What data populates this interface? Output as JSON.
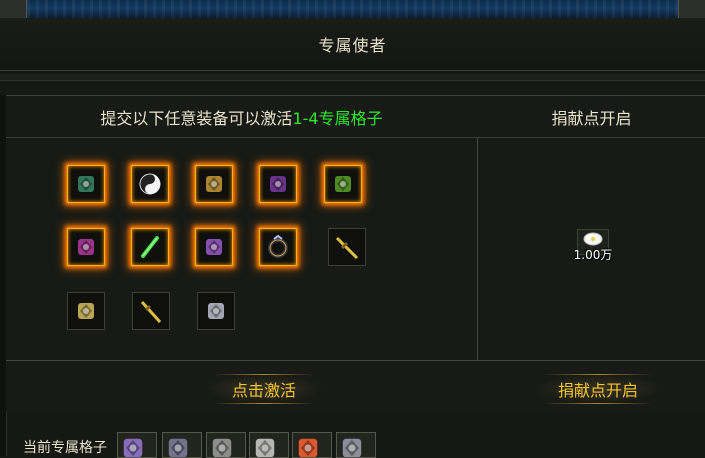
{
  "window": {
    "title": "专属使者"
  },
  "left_panel": {
    "header_prefix": "提交以下任意装备可以激活",
    "header_highlight": "1-4专属格子",
    "items": [
      {
        "icon": "green-helmet-icon",
        "glow": true,
        "color": "#3a8a6a"
      },
      {
        "icon": "yin-yang-icon",
        "glow": true,
        "color": "#ffffff"
      },
      {
        "icon": "gold-armor-icon",
        "glow": true,
        "color": "#c89a3a"
      },
      {
        "icon": "purple-armor-icon",
        "glow": true,
        "color": "#7a3aa0"
      },
      {
        "icon": "green-box-icon",
        "glow": true,
        "color": "#5aa02a"
      },
      {
        "icon": "purple-dragon-icon",
        "glow": true,
        "color": "#b03aa0"
      },
      {
        "icon": "green-wand-icon",
        "glow": true,
        "color": "#4ae04a"
      },
      {
        "icon": "purple-gauntlet-icon",
        "glow": true,
        "color": "#9a5ac8"
      },
      {
        "icon": "dark-ring-icon",
        "glow": true,
        "color": "#c8a060"
      },
      {
        "icon": "golden-sword-icon",
        "glow": false,
        "color": "#e0c040"
      },
      {
        "icon": "golden-crossbow-icon",
        "glow": false,
        "color": "#d8c060"
      },
      {
        "icon": "golden-blade-icon",
        "glow": false,
        "color": "#e0c040"
      },
      {
        "icon": "silver-armor-icon",
        "glow": false,
        "color": "#c0c0d0"
      }
    ],
    "activate_button": "点击激活"
  },
  "right_panel": {
    "header": "捐献点开启",
    "donate_item_icon": "silver-coin-icon",
    "donate_amount": "1.00万",
    "donate_button": "捐献点开启"
  },
  "bottom": {
    "label": "当前专属格子",
    "slots": [
      {
        "icon": "purple-orb-icon"
      },
      {
        "icon": "dark-dragon-icon"
      },
      {
        "icon": "spiked-weapon-icon"
      },
      {
        "icon": "steel-sword-icon"
      },
      {
        "icon": "flame-icon"
      },
      {
        "icon": "dark-blade-icon"
      }
    ]
  }
}
